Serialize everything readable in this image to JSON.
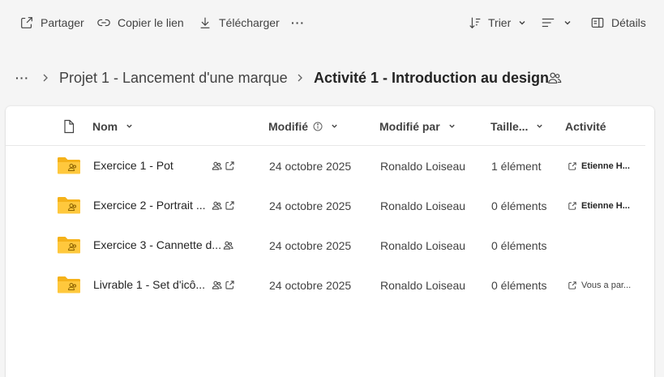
{
  "toolbar": {
    "share_label": "Partager",
    "copy_link_label": "Copier le lien",
    "download_label": "Télécharger",
    "more_label": "···",
    "sort_label": "Trier",
    "details_label": "Détails"
  },
  "breadcrumb": {
    "more_label": "···",
    "parent": "Projet 1 - Lancement d'une marque",
    "current": "Activité 1 - Introduction au design"
  },
  "table": {
    "columns": {
      "name": "Nom",
      "modified": "Modifié",
      "modified_by": "Modifié par",
      "size": "Taille...",
      "activity": "Activité"
    },
    "rows": [
      {
        "name": "Exercice 1 - Pot",
        "modified": "24 octobre 2025",
        "modified_by": "Ronaldo Loiseau",
        "size": "1 élément",
        "activity": "Etienne H..."
      },
      {
        "name": "Exercice 2 - Portrait ...",
        "modified": "24 octobre 2025",
        "modified_by": "Ronaldo Loiseau",
        "size": "0 éléments",
        "activity": "Etienne H..."
      },
      {
        "name": "Exercice 3 - Cannette d...",
        "modified": "24 octobre 2025",
        "modified_by": "Ronaldo Loiseau",
        "size": "0 éléments",
        "activity": ""
      },
      {
        "name": "Livrable 1 - Set d'icô...",
        "modified": "24 octobre 2025",
        "modified_by": "Ronaldo Loiseau",
        "size": "0 éléments",
        "activity": "Vous a par..."
      }
    ]
  },
  "colors": {
    "background": "#f5f5f5",
    "card": "#ffffff",
    "folder": "#f5b21a",
    "text": "#242424"
  }
}
